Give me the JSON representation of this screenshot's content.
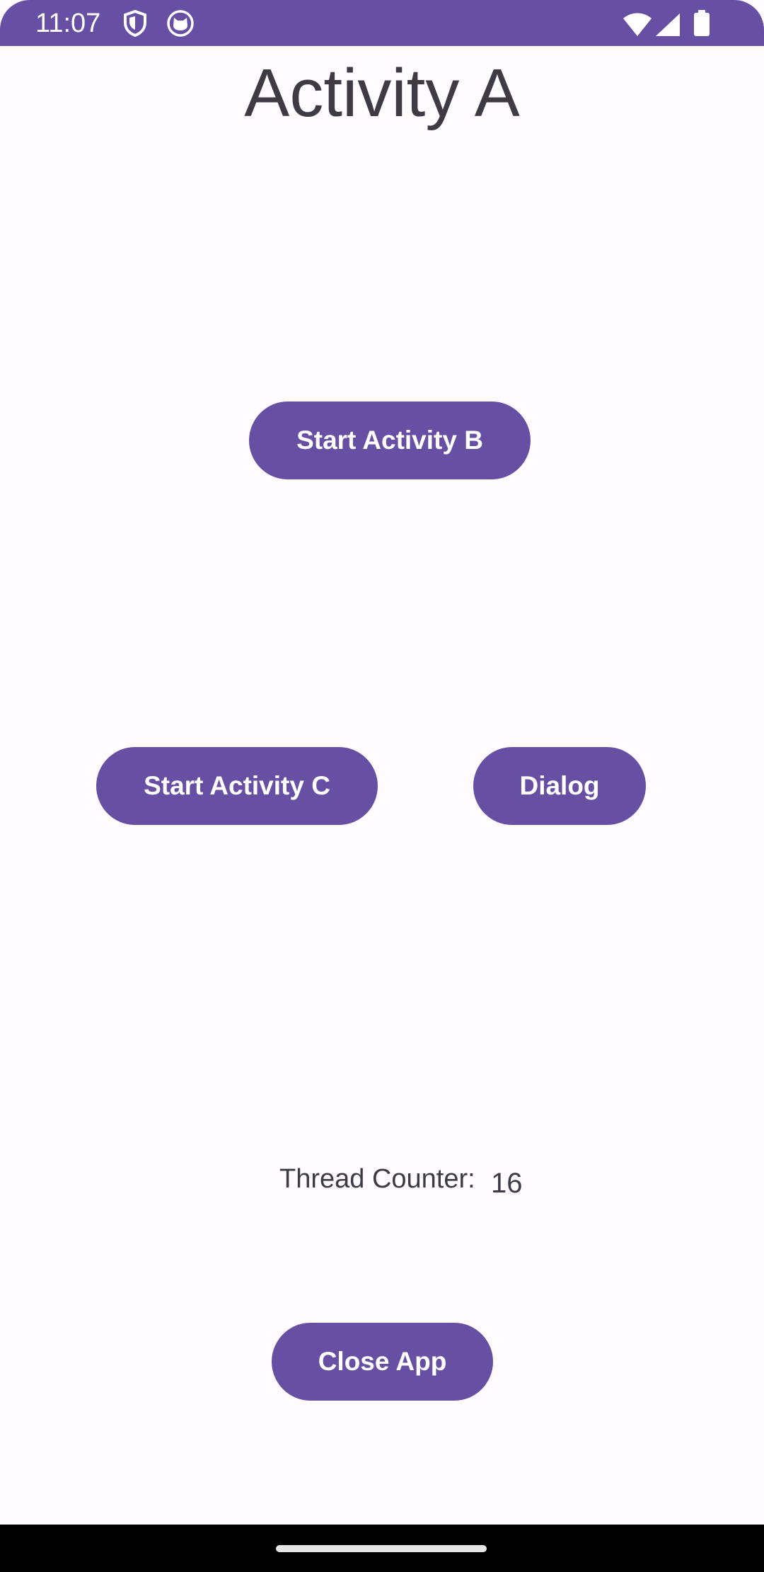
{
  "status_bar": {
    "time": "11:07",
    "icons_left": [
      "shield-icon",
      "cat-face-icon"
    ],
    "icons_right": [
      "wifi-icon",
      "cellular-signal-icon",
      "battery-icon"
    ],
    "background_color": "#6750a4"
  },
  "page": {
    "title": "Activity A"
  },
  "buttons": {
    "start_activity_b": "Start Activity B",
    "start_activity_c": "Start Activity C",
    "dialog": "Dialog",
    "close_app": "Close App"
  },
  "thread_counter": {
    "label": "Thread Counter:",
    "value": "16"
  },
  "colors": {
    "accent": "#6750a4",
    "background": "#fffbfe",
    "text": "#3f3b45"
  }
}
